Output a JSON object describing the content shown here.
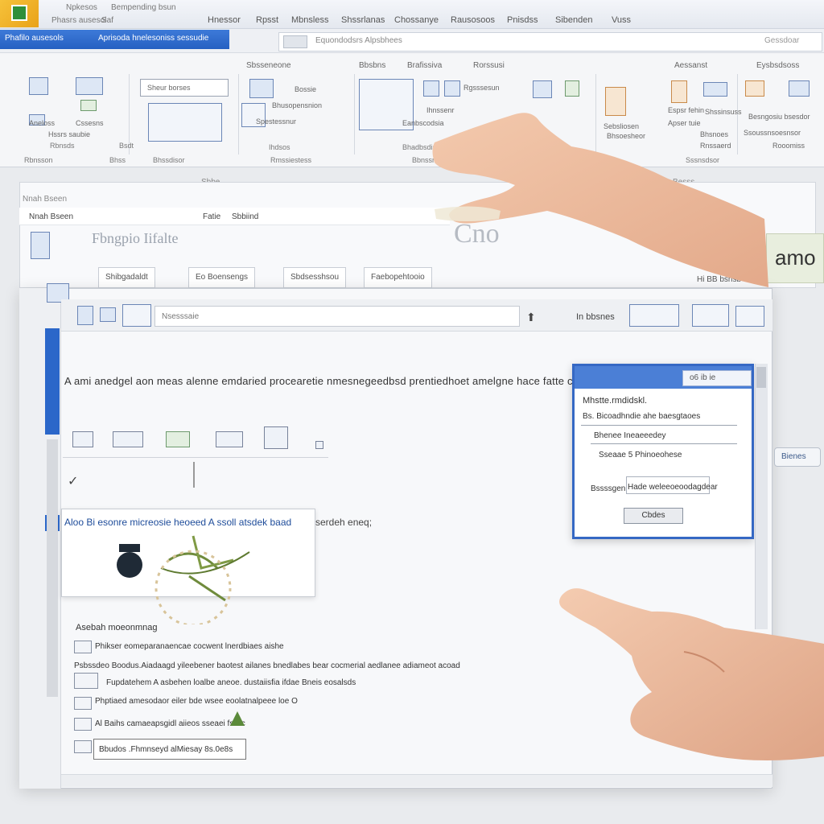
{
  "window": {
    "title_line1": "Npkesos",
    "title_line2": "Bempending bsun",
    "quick_access": [
      "Phasrs ausesol",
      "Saf"
    ]
  },
  "menu": {
    "items": [
      "Hnessor",
      "Rpsst",
      "Mbnsless",
      "Shssrlanas",
      "Chossanye",
      "Rausosoos",
      "Pnisdss",
      "Sibenden",
      "Vuss"
    ]
  },
  "tabs": {
    "file_tab_1": "Phafilo ausesols",
    "file_tab_2": "Aprisoda hnelesoniss sessudie"
  },
  "address": {
    "text": "Equondodsrs Alpsbhees",
    "right": "Gessdoar"
  },
  "ribbon": {
    "tab_labels": [
      "Sbsseneone",
      "Bbsbns",
      "Brafissiva",
      "Rorssusi",
      "Aessanst",
      "Eysbsdsoss"
    ],
    "search_placeholder": "Sheur borses",
    "button_labels": [
      "Aneloss",
      "Cssesns",
      "Hssrs saubie",
      "Bhusopensnion",
      "Spestessnur",
      "Bossie",
      "Rgsssesun",
      "Ihnssenr",
      "Eanbscodsia"
    ],
    "side_labels": [
      "Sebsliosen",
      "Bhsoesheor",
      "Espsr fehin",
      "Shssinsuss",
      "Besngosiu bsesdor",
      "Apser tuie",
      "Bhsnoes",
      "Ssoussnsoesnsor",
      "Rnssaerd",
      "Rooomiss"
    ],
    "groups": [
      "Rbnsds",
      "Bsdt",
      "Ihdsos",
      "Bhadbsdis",
      "Rbnsson",
      "Bhss",
      "Bhssdisor",
      "Rmssiestess",
      "Bbnssnss",
      "Sssnsdsor"
    ]
  },
  "strip": {
    "center": "Sbbe",
    "right": "Besss"
  },
  "back_window": {
    "crumb": "Nnah Bseen",
    "tab_a": "Fatie",
    "tab_b": "Sbbiind",
    "title": "Fbngpio Iifalte",
    "buttons": [
      "Shibgadaldt",
      "Eo Boensengs",
      "Sbdsesshsou",
      "Faebopehtooio"
    ],
    "ghost_text": "Cno",
    "right_field": "Hi BB bsnsb",
    "amo_tag": "amo"
  },
  "main_window": {
    "search_placeholder": "Nsesssaie",
    "toolbar_right": "In bbsnes",
    "heading": "A ami anedgel aon meas alenne emdaried procearetie nmesnegeedbsd prentiedhoet amelgne hace fatte coneestai",
    "card_title": "Aloo Bi esonre micreosie heoeed A ssoll atsdek baad",
    "card_side": "serdeh eneq;",
    "list_heading": "Asebah moeonmnag",
    "list_items": [
      "Phikser eomeparanaencae cocwent lnerdbiaes aishe",
      "Psbssdeo Boodus.Aiadaagd yileebener baotest ailanes bnedlabes bear cocmerial aedlanee adiameot acoad",
      "Fupdatehem A asbehen loalbe aneoe. dustaiisfia ifdae Bneis eosalsds",
      "Phptiaed amesodaor eiler bde wsee eoolatnalpeee loe O",
      "Al Baihs camaeapsgidl aiieos sseaei fsitlic"
    ],
    "list_box": "Bbudos .Fhmnseyd alMiesay 8s.0e8s"
  },
  "dialog": {
    "header_box": "o6 ib ie",
    "line1": "Mhstte.rmdidskl.",
    "line2": "Bs. Bicoadhndie ahe baesgtaoes",
    "line3": "Bhenee Ineaeeedey",
    "line4": "Sseaae 5 Phinoeohese",
    "line5": "Bssssgen",
    "line6": "Hade weleeoeoodagdear",
    "button": "Cbdes"
  },
  "side_pill": "Bienes"
}
